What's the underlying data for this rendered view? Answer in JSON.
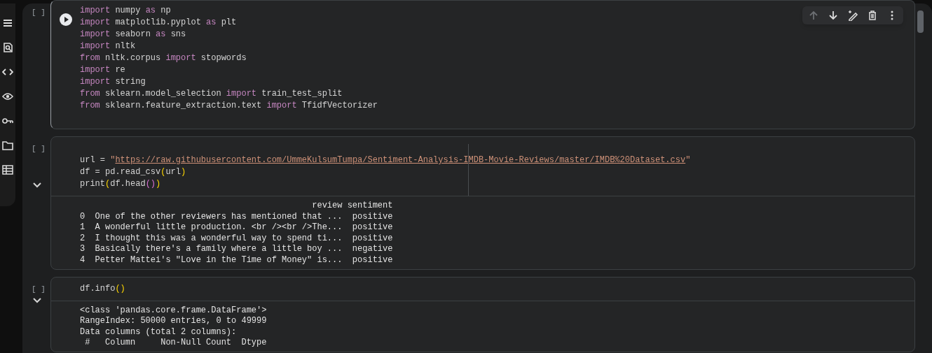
{
  "cells": [
    {
      "counter": "[ ]",
      "focused": true,
      "code": [
        [
          {
            "t": "import",
            "kind": "keyword"
          },
          {
            "t": " numpy ",
            "kind": "plain"
          },
          {
            "t": "as",
            "kind": "keyword"
          },
          {
            "t": " np",
            "kind": "plain"
          }
        ],
        [
          {
            "t": "import",
            "kind": "keyword"
          },
          {
            "t": " matplotlib.pyplot ",
            "kind": "plain"
          },
          {
            "t": "as",
            "kind": "keyword"
          },
          {
            "t": " plt",
            "kind": "plain"
          }
        ],
        [
          {
            "t": "import",
            "kind": "keyword"
          },
          {
            "t": " seaborn ",
            "kind": "plain"
          },
          {
            "t": "as",
            "kind": "keyword"
          },
          {
            "t": " sns",
            "kind": "plain"
          }
        ],
        [
          {
            "t": "import",
            "kind": "keyword"
          },
          {
            "t": " nltk",
            "kind": "plain"
          }
        ],
        [
          {
            "t": "from",
            "kind": "keyword"
          },
          {
            "t": " nltk.corpus ",
            "kind": "plain"
          },
          {
            "t": "import",
            "kind": "keyword"
          },
          {
            "t": " stopwords",
            "kind": "plain"
          }
        ],
        [
          {
            "t": "import",
            "kind": "keyword"
          },
          {
            "t": " re",
            "kind": "plain"
          }
        ],
        [
          {
            "t": "import",
            "kind": "keyword"
          },
          {
            "t": " string",
            "kind": "plain"
          }
        ],
        [
          {
            "t": "from",
            "kind": "keyword"
          },
          {
            "t": " sklearn.model_selection ",
            "kind": "plain"
          },
          {
            "t": "import",
            "kind": "keyword"
          },
          {
            "t": " train_test_split",
            "kind": "plain"
          }
        ],
        [
          {
            "t": "from",
            "kind": "keyword"
          },
          {
            "t": " sklearn.feature_extraction.text ",
            "kind": "plain"
          },
          {
            "t": "import",
            "kind": "keyword"
          },
          {
            "t": " TfidfVectorizer",
            "kind": "plain"
          }
        ]
      ],
      "toolbar": [
        {
          "kind": "up",
          "disabled": true
        },
        {
          "kind": "down",
          "disabled": false
        },
        {
          "kind": "edit",
          "disabled": false
        },
        {
          "kind": "delete",
          "disabled": false
        },
        {
          "kind": "more",
          "disabled": false
        }
      ]
    },
    {
      "counter": "[ ]",
      "focused": false,
      "code": [
        [
          {
            "t": "url = ",
            "kind": "plain"
          },
          {
            "t": "\"",
            "kind": "string"
          },
          {
            "t": "https://raw.githubusercontent.com/UmmeKulsumTumpa/Sentiment-Analysis-IMDB-Movie-Reviews/master/IMDB%20Dataset.csv",
            "kind": "link"
          },
          {
            "t": "\"",
            "kind": "string"
          }
        ],
        [
          {
            "t": "df = pd.read_csv",
            "kind": "plain"
          },
          {
            "t": "(",
            "kind": "bracket"
          },
          {
            "t": "url",
            "kind": "plain"
          },
          {
            "t": ")",
            "kind": "bracket"
          }
        ],
        [
          {
            "t": "print",
            "kind": "plain"
          },
          {
            "t": "(",
            "kind": "bracket"
          },
          {
            "t": "df.head",
            "kind": "plain"
          },
          {
            "t": "()",
            "kind": "inner"
          },
          {
            "t": ")",
            "kind": "bracket"
          }
        ]
      ],
      "output": [
        "                                              review sentiment",
        "0  One of the other reviewers has mentioned that ...  positive",
        "1  A wonderful little production. <br /><br />The...  positive",
        "2  I thought this was a wonderful way to spend ti...  positive",
        "3  Basically there's a family where a little boy ...  negative",
        "4  Petter Mattei's \"Love in the Time of Money\" is...  positive"
      ]
    },
    {
      "counter": "[ ]",
      "focused": false,
      "code": [
        [
          {
            "t": "df.info",
            "kind": "plain"
          },
          {
            "t": "()",
            "kind": "bracket"
          }
        ]
      ],
      "output": [
        "<class 'pandas.core.frame.DataFrame'>",
        "RangeIndex: 50000 entries, 0 to 49999",
        "Data columns (total 2 columns):",
        " #   Column     Non-Null Count  Dtype"
      ]
    }
  ]
}
